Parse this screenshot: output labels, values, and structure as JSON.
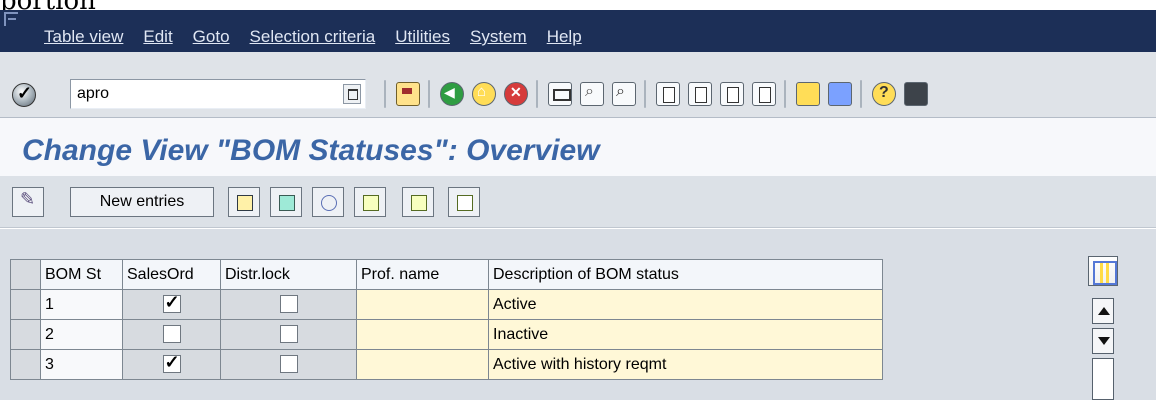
{
  "caption_text": "portion",
  "menu": {
    "items": [
      {
        "label": "Table view"
      },
      {
        "label": "Edit"
      },
      {
        "label": "Goto"
      },
      {
        "label": "Selection criteria"
      },
      {
        "label": "Utilities"
      },
      {
        "label": "System"
      },
      {
        "label": "Help"
      }
    ]
  },
  "toolbar": {
    "command_value": "apro",
    "icons": [
      "enter-icon",
      "back-icon",
      "save-icon",
      "back-arrow-icon",
      "exit-icon",
      "cancel-icon",
      "print-icon",
      "find-icon",
      "find-next-icon",
      "first-page-icon",
      "previous-page-icon",
      "next-page-icon",
      "last-page-icon",
      "create-session-icon",
      "shortcut-icon",
      "help-icon",
      "layout-icon"
    ]
  },
  "page": {
    "title": "Change View \"BOM Statuses\": Overview"
  },
  "subtoolbar": {
    "new_entries_label": "New entries"
  },
  "table": {
    "headers": [
      "BOM St",
      "SalesOrd",
      "Distr.lock",
      "Prof. name",
      "Description of BOM status"
    ],
    "rows": [
      {
        "bom_st": "1",
        "salesord_checked": true,
        "distr_lock_checked": false,
        "prof_name": "",
        "description": "Active"
      },
      {
        "bom_st": "2",
        "salesord_checked": false,
        "distr_lock_checked": false,
        "prof_name": "",
        "description": "Inactive"
      },
      {
        "bom_st": "3",
        "salesord_checked": true,
        "distr_lock_checked": false,
        "prof_name": "",
        "description": "Active with history reqmt"
      }
    ]
  }
}
